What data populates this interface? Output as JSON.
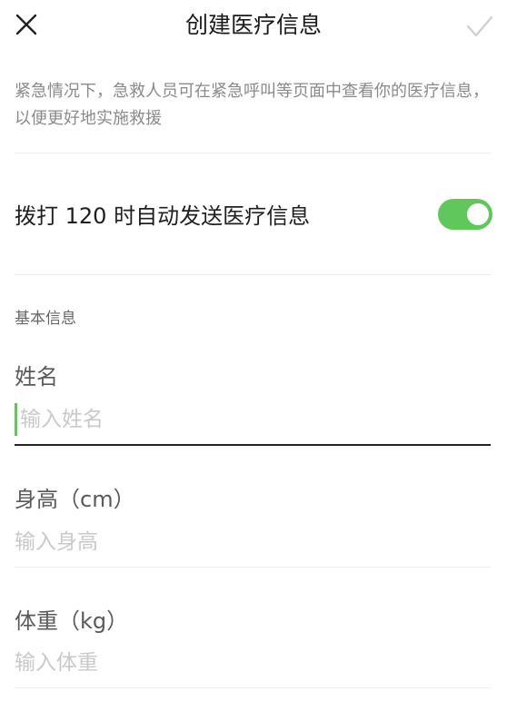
{
  "header": {
    "title": "创建医疗信息",
    "close_icon": "close-icon",
    "confirm_icon": "check-icon"
  },
  "description": "紧急情况下，急救人员可在紧急呼叫等页面中查看你的医疗信息，以便更好地实施救援",
  "auto_send": {
    "label": "拨打 120 时自动发送医疗信息",
    "enabled": true,
    "accent": "#5fc75b"
  },
  "basic_info": {
    "section_title": "基本信息",
    "fields": [
      {
        "label": "姓名",
        "placeholder": "输入姓名",
        "value": ""
      },
      {
        "label": "身高（cm）",
        "placeholder": "输入身高",
        "value": ""
      },
      {
        "label": "体重（kg）",
        "placeholder": "输入体重",
        "value": ""
      }
    ]
  }
}
